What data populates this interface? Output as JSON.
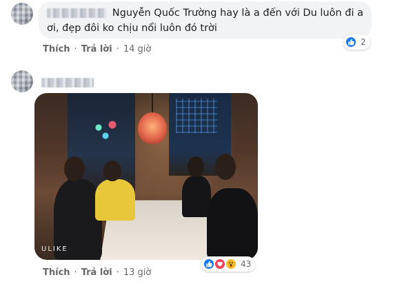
{
  "comments": [
    {
      "text_line1": "Nguyễn Quốc Trường hay là a đến với Du luôn đi a",
      "text_line2": "ơi, đẹp đôi ko chịu nổi luôn đó trời",
      "actions": {
        "like": "Thích",
        "reply": "Trả lời",
        "time": "14 giờ"
      },
      "reactions": {
        "icons": [
          "like-icon"
        ],
        "count": "2"
      }
    },
    {
      "photo": {
        "watermark": "ULIKE"
      },
      "actions": {
        "like": "Thích",
        "reply": "Trả lời",
        "time": "13 giờ"
      },
      "reactions": {
        "icons": [
          "like-icon",
          "love-icon",
          "wow-icon"
        ],
        "count": "43"
      }
    }
  ],
  "colors": {
    "bubble": "#f2f3f5",
    "meta_text": "#65676b",
    "like_blue": "#1877f2",
    "love_red": "#f33e58",
    "wow_yellow": "#f7b928"
  }
}
